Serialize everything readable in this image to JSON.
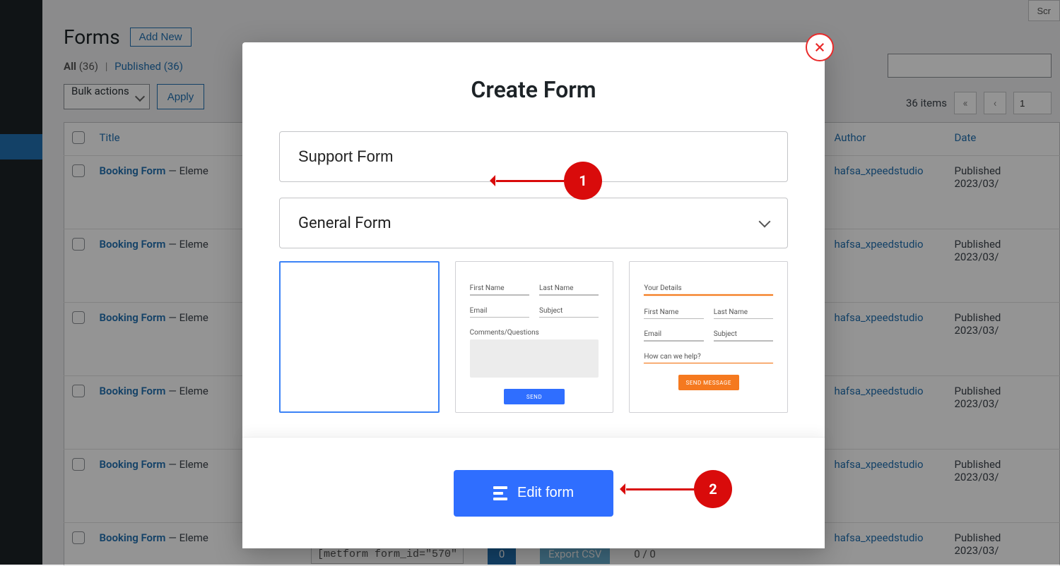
{
  "screen_options": "Scr",
  "page_title": "Forms",
  "add_new": "Add New",
  "filters": {
    "all_label": "All",
    "all_count": "(36)",
    "separator": "|",
    "published_label": "Published",
    "published_count": "(36)"
  },
  "bulk": {
    "label": "Bulk actions",
    "apply": "Apply"
  },
  "items_count": "36 items",
  "page_number": "1",
  "pager_prev_first": "«",
  "pager_prev": "‹",
  "table": {
    "col_title": "Title",
    "col_author": "Author",
    "col_date": "Date",
    "rows": [
      {
        "title": "Booking Form",
        "suffix": " — Eleme",
        "author": "hafsa_xpeedstudio",
        "date_label": "Published",
        "date_value": "2023/03/"
      },
      {
        "title": "Booking Form",
        "suffix": " — Eleme",
        "author": "hafsa_xpeedstudio",
        "date_label": "Published",
        "date_value": "2023/03/"
      },
      {
        "title": "Booking Form",
        "suffix": " — Eleme",
        "author": "hafsa_xpeedstudio",
        "date_label": "Published",
        "date_value": "2023/03/"
      },
      {
        "title": "Booking Form",
        "suffix": " — Eleme",
        "author": "hafsa_xpeedstudio",
        "date_label": "Published",
        "date_value": "2023/03/"
      },
      {
        "title": "Booking Form",
        "suffix": " — Eleme",
        "author": "hafsa_xpeedstudio",
        "date_label": "Published",
        "date_value": "2023/03/"
      },
      {
        "title": "Booking Form",
        "suffix": " — Eleme",
        "author": "hafsa_xpeedstudio",
        "date_label": "Published",
        "date_value": "2023/03/"
      }
    ]
  },
  "row_snippet": {
    "shortcode": "[metform form_id=\"570\"",
    "count": "0",
    "export": "Export CSV",
    "ratio": "0 / 0"
  },
  "modal": {
    "title": "Create Form",
    "name_value": "Support Form",
    "type_value": "General Form",
    "edit_button": "Edit form",
    "templates": {
      "t2": {
        "f1": "First Name",
        "f2": "Last Name",
        "f3": "Email",
        "f4": "Subject",
        "comments": "Comments/Questions",
        "btn": "SEND"
      },
      "t3": {
        "head": "Your Details",
        "f1": "First Name",
        "f2": "Last Name",
        "f3": "Email",
        "f4": "Subject",
        "help": "How can we help?",
        "btn": "SEND MESSAGE"
      }
    }
  },
  "annotations": {
    "a1": "1",
    "a2": "2"
  }
}
